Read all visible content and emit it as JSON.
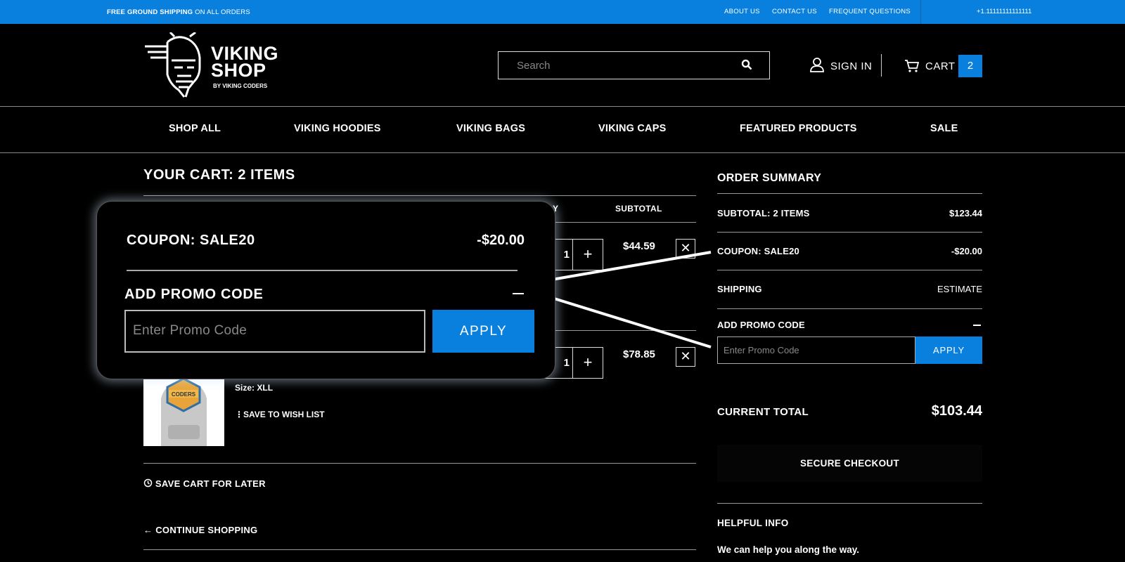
{
  "topbar": {
    "shipping_bold": "FREE GROUND SHIPPING",
    "shipping_rest": "ON ALL ORDERS",
    "links": [
      "ABOUT US",
      "CONTACT US",
      "FREQUENT QUESTIONS"
    ],
    "phone": "+1.11111111111111",
    "color": "#0a80de"
  },
  "header": {
    "logo_line1": "VIKING",
    "logo_line2": "SHOP",
    "logo_sub": "BY VIKING CODERS",
    "search_placeholder": "Search",
    "sign_in": "SIGN IN",
    "cart_label": "CART",
    "cart_count": "2"
  },
  "nav": [
    "SHOP ALL",
    "VIKING HOODIES",
    "VIKING BAGS",
    "VIKING CAPS",
    "FEATURED PRODUCTS",
    "SALE"
  ],
  "cart": {
    "title": "YOUR CART: 2 ITEMS",
    "col_qty": "Y",
    "col_subtotal": "SUBTOTAL",
    "items": [
      {
        "qty": "1",
        "plus": "+",
        "price": "$44.59",
        "remove": "✕"
      },
      {
        "qty": "1",
        "plus": "+",
        "price": "$78.85",
        "remove": "✕",
        "size_label": "Size:",
        "size_value": "XLL",
        "wish": "SAVE TO WISH LIST",
        "image_text": "CODERS"
      }
    ],
    "save_later": "SAVE CART FOR LATER",
    "continue": "CONTINUE SHOPPING"
  },
  "summary": {
    "title": "ORDER SUMMARY",
    "subtotal_label": "SUBTOTAL: 2 ITEMS",
    "subtotal_value": "$123.44",
    "coupon_label": "COUPON: SALE20",
    "coupon_value": "-$20.00",
    "shipping_label": "SHIPPING",
    "shipping_value": "ESTIMATE",
    "promo_label": "ADD PROMO CODE",
    "promo_placeholder": "Enter Promo Code",
    "apply": "APPLY",
    "total_label": "CURRENT TOTAL",
    "total_value": "$103.44",
    "checkout": "SECURE CHECKOUT",
    "help_title": "HELPFUL INFO",
    "help_text": "We can help you along the way."
  },
  "callout": {
    "coupon_label": "COUPON: SALE20",
    "coupon_value": "-$20.00",
    "promo_label": "ADD PROMO CODE",
    "promo_placeholder": "Enter Promo Code",
    "apply": "APPLY"
  }
}
